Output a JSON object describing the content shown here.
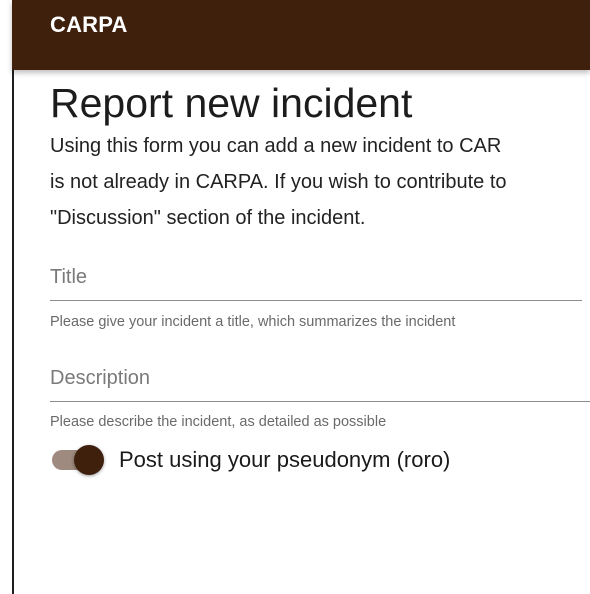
{
  "app_bar": {
    "title": "CARPA"
  },
  "page": {
    "title": "Report new incident",
    "intro_lines": [
      "Using this form you can add a new incident to CAR",
      "is not already in CARPA. If you wish to contribute to",
      "\"Discussion\" section of the incident."
    ]
  },
  "form": {
    "title_field": {
      "label": "Title",
      "value": "",
      "helper": "Please give your incident a title, which summarizes the incident"
    },
    "description_field": {
      "label": "Description",
      "value": "",
      "helper": "Please describe the incident, as detailed as possible"
    },
    "pseudonym_toggle": {
      "label": "Post using your pseudonym (roro)",
      "checked": true
    }
  },
  "colors": {
    "brand": "#3e200c",
    "toggle_track": "#9e8a7e"
  }
}
